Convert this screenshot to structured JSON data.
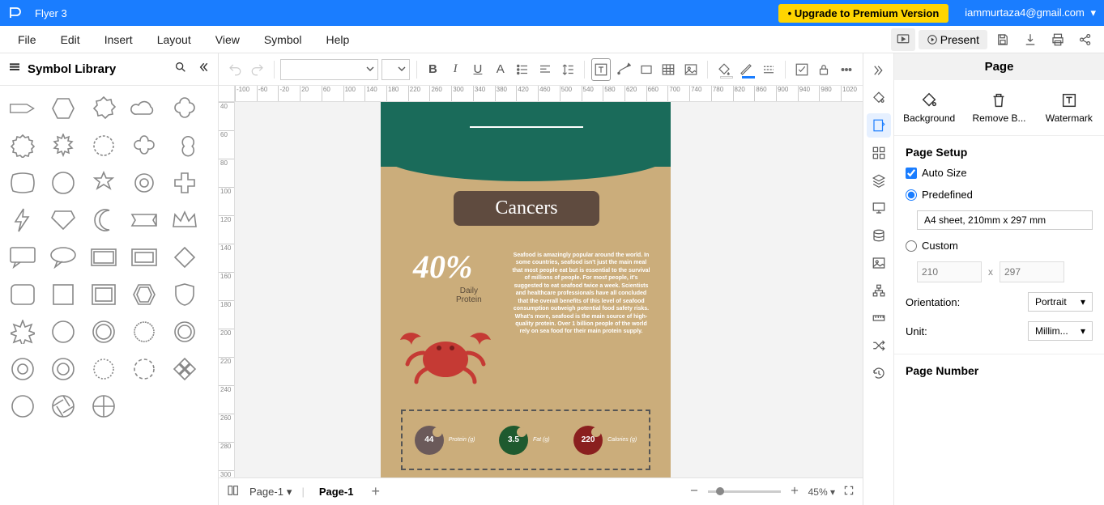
{
  "titlebar": {
    "doc_title": "Flyer 3",
    "upgrade_label": "Upgrade to Premium Version",
    "user_email": "iammurtaza4@gmail.com"
  },
  "menubar": {
    "items": [
      "File",
      "Edit",
      "Insert",
      "Layout",
      "View",
      "Symbol",
      "Help"
    ],
    "present_label": "Present"
  },
  "leftpanel": {
    "title": "Symbol Library"
  },
  "hruler_ticks": [
    "-100",
    "-60",
    "-20",
    "20",
    "60",
    "100",
    "140",
    "180",
    "220",
    "260",
    "300",
    "340",
    "380",
    "420",
    "460",
    "500",
    "540",
    "580",
    "620",
    "660",
    "700",
    "740",
    "780",
    "820",
    "860",
    "900",
    "940",
    "980",
    "1020"
  ],
  "vruler_ticks": [
    "40",
    "60",
    "80",
    "100",
    "120",
    "140",
    "160",
    "180",
    "200",
    "220",
    "240",
    "260",
    "280",
    "300"
  ],
  "canvas": {
    "title": "Cancers",
    "percent": "40%",
    "daily_protein_l1": "Daily",
    "daily_protein_l2": "Protein",
    "body": "Seafood is amazingly popular around the world. In some countries, seafood isn't just the main meal that most people eat but is essential to the survival of millions of people. For most people, it's suggested to eat seafood twice a week. Scientists and healthcare professionals have all concluded that the overall benefits of this level of seafood consumption outweigh potential food safety risks. What's more, seafood is the main source of high-quality protein. Over 1 billion people of the world rely on sea food for their main protein supply.",
    "nutri": [
      {
        "value": "44",
        "label": "Protein (g)"
      },
      {
        "value": "3.5",
        "label": "Fat (g)"
      },
      {
        "value": "220",
        "label": "Calories (g)"
      }
    ]
  },
  "rightpanel": {
    "title": "Page",
    "actions": {
      "background": "Background",
      "remove_bg": "Remove B...",
      "watermark": "Watermark"
    },
    "page_setup_title": "Page Setup",
    "auto_size_label": "Auto Size",
    "predefined_label": "Predefined",
    "predefined_value": "A4 sheet, 210mm x 297 mm",
    "custom_label": "Custom",
    "width_ph": "210",
    "height_ph": "297",
    "orientation_label": "Orientation:",
    "orientation_value": "Portrait",
    "unit_label": "Unit:",
    "unit_value": "Millim...",
    "page_number_title": "Page Number"
  },
  "pagebar": {
    "page_select": "Page-1",
    "page_tab": "Page-1",
    "zoom_value": "45%"
  }
}
